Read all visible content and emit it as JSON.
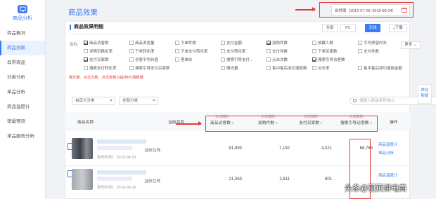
{
  "sidebar": {
    "title": "商品分析",
    "items": [
      {
        "label": "商品概况",
        "active": false
      },
      {
        "label": "商品效果",
        "active": true
      },
      {
        "label": "异常商品",
        "active": false
      },
      {
        "label": "分类分析",
        "active": false
      },
      {
        "label": "单品分析",
        "active": false
      },
      {
        "label": "商品温度计",
        "active": false
      },
      {
        "label": "销量预测",
        "active": false
      },
      {
        "label": "单品服务分析",
        "active": false
      }
    ]
  },
  "header": {
    "title": "商品效果",
    "date_range": "自然周（2019-07-29~2019-08-04）"
  },
  "panel": {
    "title": "商品效果明细",
    "terminals": [
      "全部",
      "PC",
      "无线"
    ],
    "active_terminal": "无线",
    "download": "下载"
  },
  "metrics": {
    "label": "指标:",
    "items": [
      {
        "label": "商品访客数",
        "checked": true
      },
      {
        "label": "商品浏览量",
        "checked": false
      },
      {
        "label": "下单件数",
        "checked": false
      },
      {
        "label": "支付金额",
        "checked": false
      },
      {
        "label": "加购件数",
        "checked": true
      },
      {
        "label": "收藏人数",
        "checked": false
      },
      {
        "label": "平均停留时长",
        "checked": false
      },
      {
        "label": "详情页跳出率",
        "checked": false
      },
      {
        "label": "下单转化率",
        "checked": false
      },
      {
        "label": "下单支付转化率",
        "checked": false
      },
      {
        "label": "支付转化率",
        "checked": false
      },
      {
        "label": "支付件数",
        "checked": false
      },
      {
        "label": "下单买家数",
        "checked": false
      },
      {
        "label": "支付件数",
        "checked": false
      },
      {
        "label": "支付买家数",
        "checked": true
      },
      {
        "label": "访客平均价值",
        "checked": false
      },
      {
        "label": "客单价",
        "checked": false
      },
      {
        "label": "搜索引导支付...",
        "checked": false
      },
      {
        "label": "点击次数",
        "checked": false
      },
      {
        "label": "搜索引导访客数",
        "checked": true
      },
      {
        "label": "搜索支付转化率",
        "checked": false
      },
      {
        "label": "搜索引导支付买家数",
        "checked": false
      },
      {
        "label": "曝光量",
        "checked": false
      },
      {
        "label": "售中售后成功退款数",
        "checked": false
      },
      {
        "label": "点击率",
        "checked": false
      },
      {
        "label": "售中售后成功退款金额",
        "checked": false
      }
    ],
    "more": "更多",
    "note": "曝光量、点击次数、点击率暂只提供PC端数据"
  },
  "filters": {
    "category": "自定义分类",
    "scope": "全部分类",
    "search_placeholder": "请输入商品名称或ID"
  },
  "table": {
    "columns": [
      {
        "label": "商品名称"
      },
      {
        "label": "当前状态"
      },
      {
        "sub": "无线端的",
        "label": "商品访客数"
      },
      {
        "sub": "无线端的",
        "label": "加购件数"
      },
      {
        "sub": "无线端的",
        "label": "支付买家数"
      },
      {
        "sub": "无线端的",
        "label": "搜索引导访客数"
      },
      {
        "label": "操作"
      }
    ],
    "rows": [
      {
        "published": "发布时间：2019-04-02",
        "status": "当前在线",
        "visitors": "81,993",
        "cart_items": "7,192",
        "buyers": "4,021",
        "search_visitors": "68,769",
        "actions": [
          "商品温度计",
          "单品分析"
        ]
      },
      {
        "published": "发布时间：2019-08-16",
        "status": "当前在线",
        "visitors": "21,063",
        "cart_items": "2,611",
        "buyers": "801",
        "search_visitors": "",
        "actions": [
          "商品温度计"
        ]
      }
    ]
  },
  "float_side": {
    "line1": "体验",
    "line2": "新版"
  },
  "watermark": "头条@羽页讲电商",
  "colors": {
    "accent": "#3a7bf4",
    "highlight": "#e53935"
  }
}
